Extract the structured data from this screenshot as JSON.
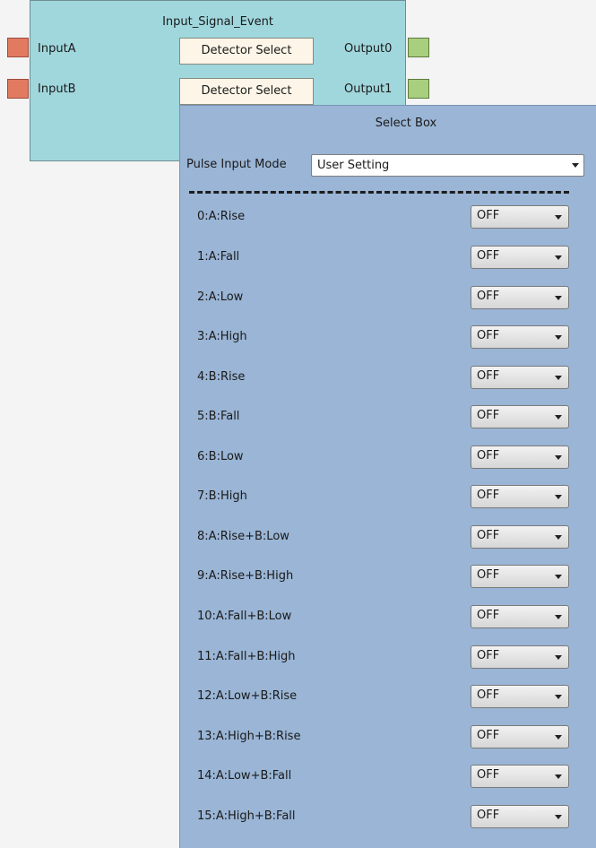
{
  "block": {
    "title": "Input_Signal_Event",
    "inputs": [
      "InputA",
      "InputB"
    ],
    "outputs": [
      "Output0",
      "Output1"
    ],
    "detector_buttons": [
      "Detector Select",
      "Detector Select"
    ]
  },
  "select_box": {
    "title": "Select Box",
    "mode_label": "Pulse Input Mode",
    "mode_value": "User Setting",
    "rows": [
      {
        "label": "0:A:Rise",
        "value": "OFF"
      },
      {
        "label": "1:A:Fall",
        "value": "OFF"
      },
      {
        "label": "2:A:Low",
        "value": "OFF"
      },
      {
        "label": "3:A:High",
        "value": "OFF"
      },
      {
        "label": "4:B:Rise",
        "value": "OFF"
      },
      {
        "label": "5:B:Fall",
        "value": "OFF"
      },
      {
        "label": "6:B:Low",
        "value": "OFF"
      },
      {
        "label": "7:B:High",
        "value": "OFF"
      },
      {
        "label": "8:A:Rise+B:Low",
        "value": "OFF"
      },
      {
        "label": "9:A:Rise+B:High",
        "value": "OFF"
      },
      {
        "label": "10:A:Fall+B:Low",
        "value": "OFF"
      },
      {
        "label": "11:A:Fall+B:High",
        "value": "OFF"
      },
      {
        "label": "12:A:Low+B:Rise",
        "value": "OFF"
      },
      {
        "label": "13:A:High+B:Rise",
        "value": "OFF"
      },
      {
        "label": "14:A:Low+B:Fall",
        "value": "OFF"
      },
      {
        "label": "15:A:High+B:Fall",
        "value": "OFF"
      }
    ]
  },
  "colors": {
    "block_bg": "#a0d7dd",
    "panel_bg": "#9ab5d5",
    "input_port": "#e27a62",
    "output_port": "#a8cf7e"
  }
}
